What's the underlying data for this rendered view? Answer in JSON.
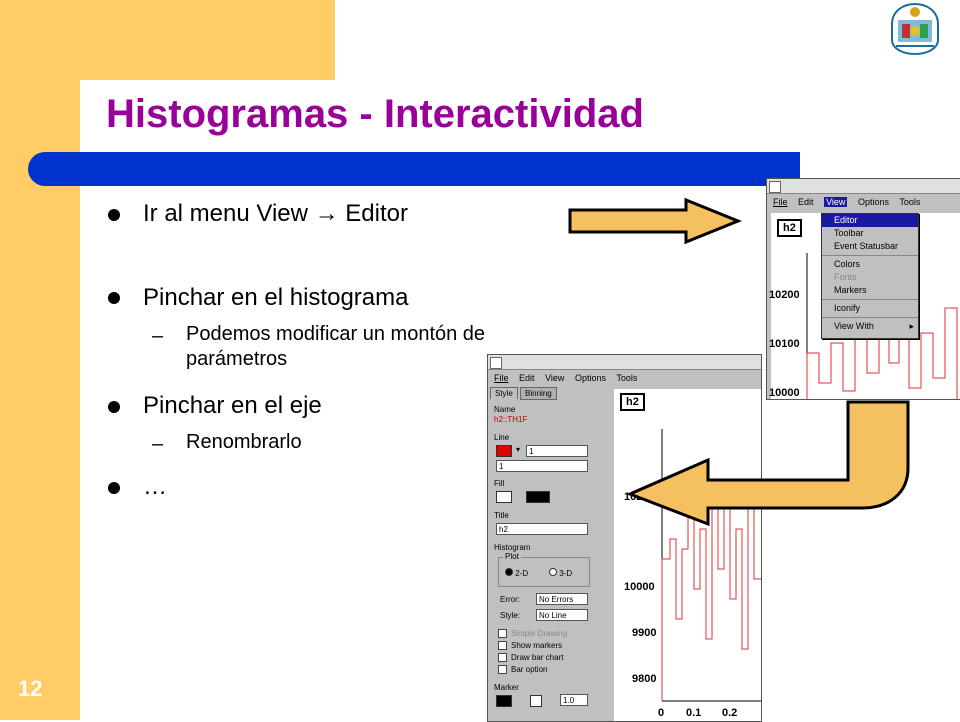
{
  "slide": {
    "title": "Histogramas - Interactividad",
    "page_number": "12",
    "bullets": [
      {
        "text": "Ir al menu View → Editor"
      },
      {
        "text": "Pinchar en el histograma",
        "sub": "Podemos modificar un montón de parámetros"
      },
      {
        "text": "Pinchar en el eje",
        "sub": "Renombrarlo"
      },
      {
        "text": "…"
      }
    ],
    "sub_line1": "Podemos modificar un montón de",
    "sub_line2": "parámetros"
  },
  "colors": {
    "band": "#ffcc66",
    "title": "#990099",
    "bar": "#0033cc",
    "arrow": "#f5c160"
  },
  "window_top": {
    "menu": [
      "File",
      "Edit",
      "View",
      "Options",
      "Tools"
    ],
    "pad_label": "h2",
    "view_menu": [
      "Editor",
      "Toolbar",
      "Event Statusbar",
      "Colors",
      "Fonts",
      "Markers",
      "Iconify",
      "View With"
    ],
    "y_ticks": [
      "10200",
      "10100",
      "10000"
    ]
  },
  "window_bottom": {
    "menu": [
      "File",
      "Edit",
      "View",
      "Options",
      "Tools"
    ],
    "tabs": [
      "Style",
      "Binning"
    ],
    "pad_label": "h2",
    "editor": {
      "name_label": "Name",
      "name_value": "h2::TH1F",
      "line_label": "Line",
      "line_width": "1",
      "fill_label": "Fill",
      "title_label": "Title",
      "title_value": "h2",
      "histogram_label": "Histogram",
      "plot_label": "Plot",
      "plot_2d": "2-D",
      "plot_3d": "3-D",
      "error_label": "Error:",
      "error_value": "No Errors",
      "style_label": "Style:",
      "style_value": "No Line",
      "checkboxes": [
        "Simple Drawing",
        "Show markers",
        "Draw bar chart",
        "Bar option"
      ],
      "marker_label": "Marker",
      "marker_size": "1.0"
    },
    "y_ticks": [
      "10200",
      "10000",
      "9900",
      "9800"
    ],
    "x_ticks": [
      "0",
      "0.1",
      "0.2"
    ]
  }
}
